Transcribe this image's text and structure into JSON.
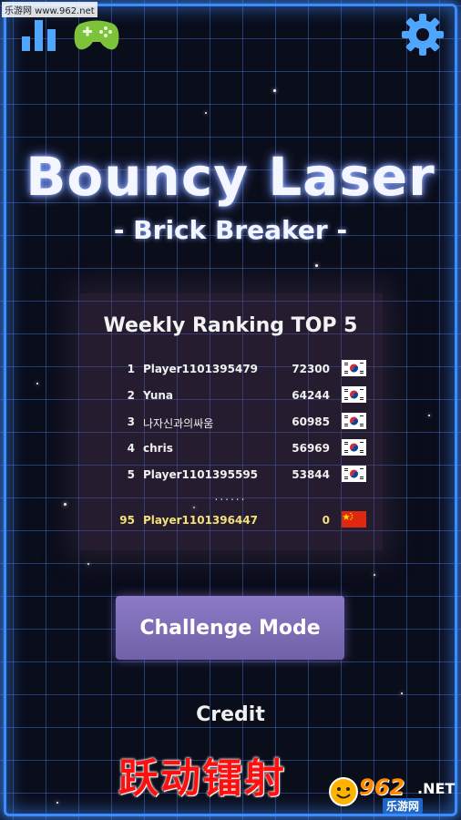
{
  "watermark_top": "乐游网 www.962.net",
  "game": {
    "title": "Bouncy Laser",
    "subtitle": "- Brick Breaker -"
  },
  "icons": {
    "leaderboard": "bar-chart-icon",
    "games_service": "gamepad-icon",
    "settings": "gear-icon"
  },
  "ranking": {
    "title": "Weekly Ranking TOP 5",
    "rows": [
      {
        "rank": "1",
        "name": "Player1101395479",
        "score": "72300",
        "flag": "KR"
      },
      {
        "rank": "2",
        "name": "Yuna",
        "score": "64244",
        "flag": "KR"
      },
      {
        "rank": "3",
        "name": "나자신과의싸움",
        "score": "60985",
        "flag": "KR"
      },
      {
        "rank": "4",
        "name": "chris",
        "score": "56969",
        "flag": "KR"
      },
      {
        "rank": "5",
        "name": "Player1101395595",
        "score": "53844",
        "flag": "KR"
      }
    ],
    "separator": "......",
    "me": {
      "rank": "95",
      "name": "Player1101396447",
      "score": "0",
      "flag": "CN"
    }
  },
  "buttons": {
    "challenge": "Challenge Mode",
    "credit": "Credit"
  },
  "overlay": {
    "chinese_title": "跃动镭射",
    "logo_main": "962",
    "logo_net": ".NET",
    "logo_sub": "乐游网"
  },
  "colors": {
    "grid": "#4678dc",
    "frame": "#3c8cff",
    "me_highlight": "#f3e07a",
    "button": "#7d6eb8"
  }
}
